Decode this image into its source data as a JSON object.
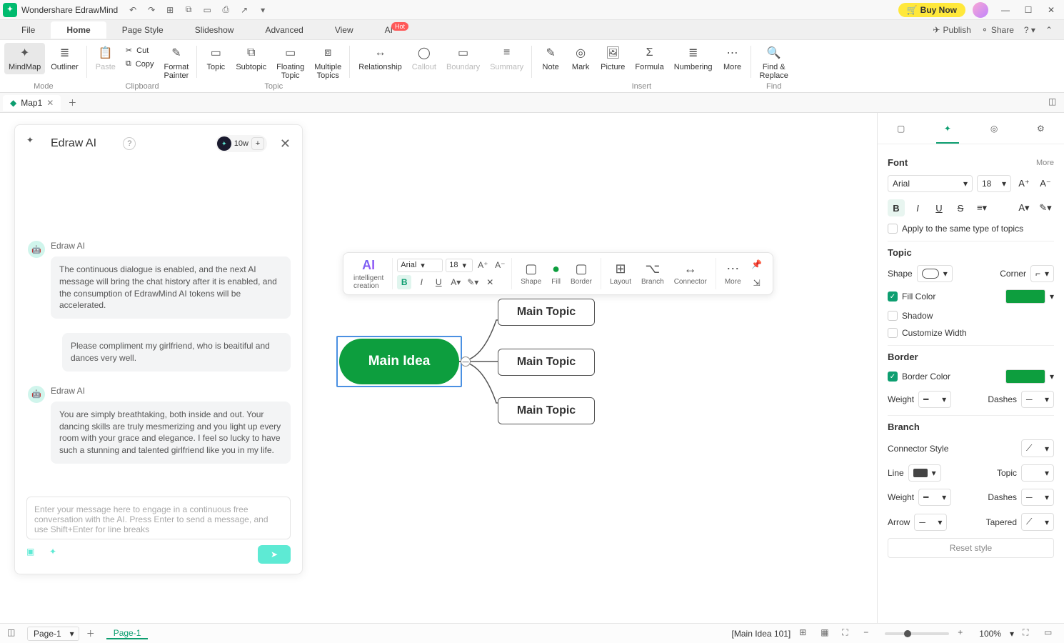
{
  "app": {
    "title": "Wondershare EdrawMind",
    "buy_now": "Buy Now"
  },
  "menu": {
    "file": "File",
    "home": "Home",
    "page_style": "Page Style",
    "slideshow": "Slideshow",
    "advanced": "Advanced",
    "view": "View",
    "ai": "AI",
    "ai_badge": "Hot",
    "publish": "Publish",
    "share": "Share"
  },
  "ribbon": {
    "mindmap": "MindMap",
    "outliner": "Outliner",
    "mode": "Mode",
    "paste": "Paste",
    "cut": "Cut",
    "copy": "Copy",
    "format_painter": "Format\nPainter",
    "clipboard": "Clipboard",
    "topic": "Topic",
    "subtopic": "Subtopic",
    "floating_topic": "Floating\nTopic",
    "multiple_topics": "Multiple\nTopics",
    "topic_group": "Topic",
    "relationship": "Relationship",
    "callout": "Callout",
    "boundary": "Boundary",
    "summary": "Summary",
    "note": "Note",
    "mark": "Mark",
    "picture": "Picture",
    "formula": "Formula",
    "numbering": "Numbering",
    "more": "More",
    "insert": "Insert",
    "find_replace": "Find &\nReplace",
    "find": "Find"
  },
  "doctab": {
    "name": "Map1"
  },
  "ai": {
    "title": "Edraw AI",
    "tokens": "10w",
    "sender": "Edraw AI",
    "msg1": "The continuous dialogue is enabled, and the next AI message will bring the chat history after it is enabled, and the consumption of EdrawMind AI tokens will be accelerated.",
    "user_msg": "Please compliment my girlfriend, who is beaitiful and dances very well.",
    "msg2": "You are simply breathtaking, both inside and out. Your dancing skills are truly mesmerizing and you light up every room with your grace and elegance. I feel so lucky to have such a stunning and talented girlfriend like you in my life.",
    "placeholder": "Enter your message here to engage in a continuous free conversation with the AI. Press Enter to send a message, and use Shift+Enter for line breaks"
  },
  "float": {
    "ai": "AI",
    "intelligent": "intelligent\ncreation",
    "font": "Arial",
    "size": "18",
    "shape": "Shape",
    "fill": "Fill",
    "border": "Border",
    "layout": "Layout",
    "branch": "Branch",
    "connector": "Connector",
    "more": "More"
  },
  "nodes": {
    "main": "Main Idea",
    "topic1": "Main Topic",
    "topic2": "Main Topic",
    "topic3": "Main Topic"
  },
  "side": {
    "font": "Font",
    "more": "More",
    "font_family": "Arial",
    "font_size": "18",
    "apply": "Apply to the same type of topics",
    "topic": "Topic",
    "shape": "Shape",
    "corner": "Corner",
    "fill_color": "Fill Color",
    "shadow": "Shadow",
    "customize_width": "Customize Width",
    "border": "Border",
    "border_color": "Border Color",
    "weight": "Weight",
    "dashes": "Dashes",
    "branch": "Branch",
    "connector_style": "Connector Style",
    "line": "Line",
    "topic_l": "Topic",
    "arrow": "Arrow",
    "tapered": "Tapered",
    "reset": "Reset style"
  },
  "status": {
    "page": "Page-1",
    "page_link": "Page-1",
    "selection": "[Main Idea 101]",
    "zoom": "100%"
  }
}
